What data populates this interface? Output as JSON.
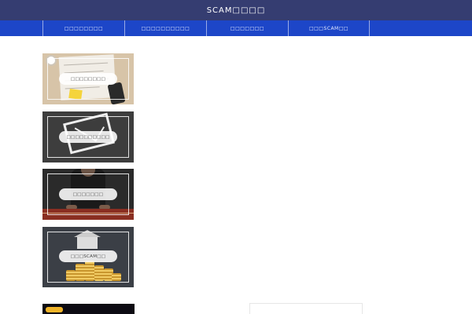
{
  "header": {
    "site_title": "SCAM□□□□"
  },
  "nav": {
    "items": [
      {
        "label": "□□□□□□□□"
      },
      {
        "label": "□□□□□□□□□□"
      },
      {
        "label": "□□□□□□□"
      },
      {
        "label": "□□□SCAM□□"
      }
    ]
  },
  "cards": [
    {
      "label": "□□□□□□□□"
    },
    {
      "label": "□□□□□□□□□□"
    },
    {
      "label": "□□□□□□□"
    },
    {
      "label": "□□□SCAM□□"
    }
  ],
  "colors": {
    "header_bg": "#353d71",
    "nav_bg": "#1d46c8",
    "accent_tag": "#f0b429"
  }
}
